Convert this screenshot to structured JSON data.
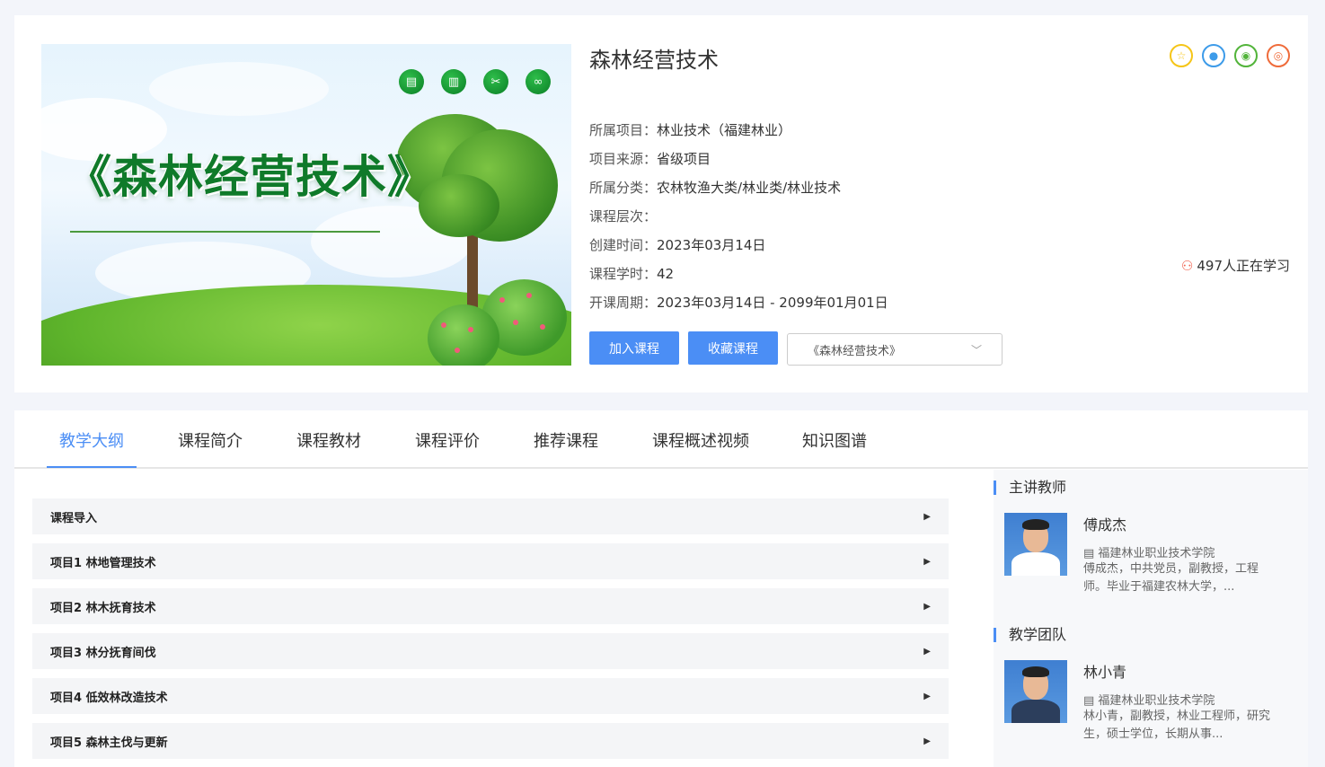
{
  "banner": {
    "title": "《森林经营技术》",
    "icons": [
      "resource-icon",
      "book-icon",
      "tools-icon",
      "link-icon"
    ]
  },
  "course": {
    "title": "森林经营技术",
    "info": [
      {
        "label": "所属项目：",
        "value": "林业技术（福建林业）"
      },
      {
        "label": "项目来源：",
        "value": "省级项目"
      },
      {
        "label": "所属分类：",
        "value": "农林牧渔大类/林业类/林业技术"
      },
      {
        "label": "课程层次：",
        "value": ""
      },
      {
        "label": "创建时间：",
        "value": "2023年03月14日"
      },
      {
        "label": "课程学时：",
        "value": "42"
      },
      {
        "label": "开课周期：",
        "value": "2023年03月14日 - 2099年01月01日"
      }
    ],
    "learners": "497人正在学习",
    "join_label": "加入课程",
    "favorite_label": "收藏课程",
    "select_value": "《森林经营技术》"
  },
  "share": [
    {
      "name": "favorite-star-icon",
      "glyph": "☆",
      "color": "#f5c518"
    },
    {
      "name": "qq-icon",
      "glyph": "●",
      "color": "#3d9be9"
    },
    {
      "name": "wechat-icon",
      "glyph": "◉",
      "color": "#52b43a"
    },
    {
      "name": "weibo-icon",
      "glyph": "◎",
      "color": "#ef6b3a"
    }
  ],
  "tabs": [
    "教学大纲",
    "课程简介",
    "课程教材",
    "课程评价",
    "推荐课程",
    "课程概述视频",
    "知识图谱"
  ],
  "syllabus": [
    "课程导入",
    "项目1 林地管理技术",
    "项目2 林木抚育技术",
    "项目3 林分抚育间伐",
    "项目4 低效林改造技术",
    "项目5 森林主伐与更新"
  ],
  "sidebar": {
    "lead_title": "主讲教师",
    "team_title": "教学团队",
    "lead": {
      "name": "傅成杰",
      "school": "福建林业职业技术学院",
      "desc": "傅成杰，中共党员，副教授，工程师。毕业于福建农林大学，..."
    },
    "team": [
      {
        "name": "林小青",
        "school": "福建林业职业技术学院",
        "desc": "林小青，副教授，林业工程师，研究生，硕士学位，长期从事..."
      }
    ]
  },
  "colors": {
    "accent": "#4b8ef5",
    "learners_icon": "#f0624f"
  }
}
